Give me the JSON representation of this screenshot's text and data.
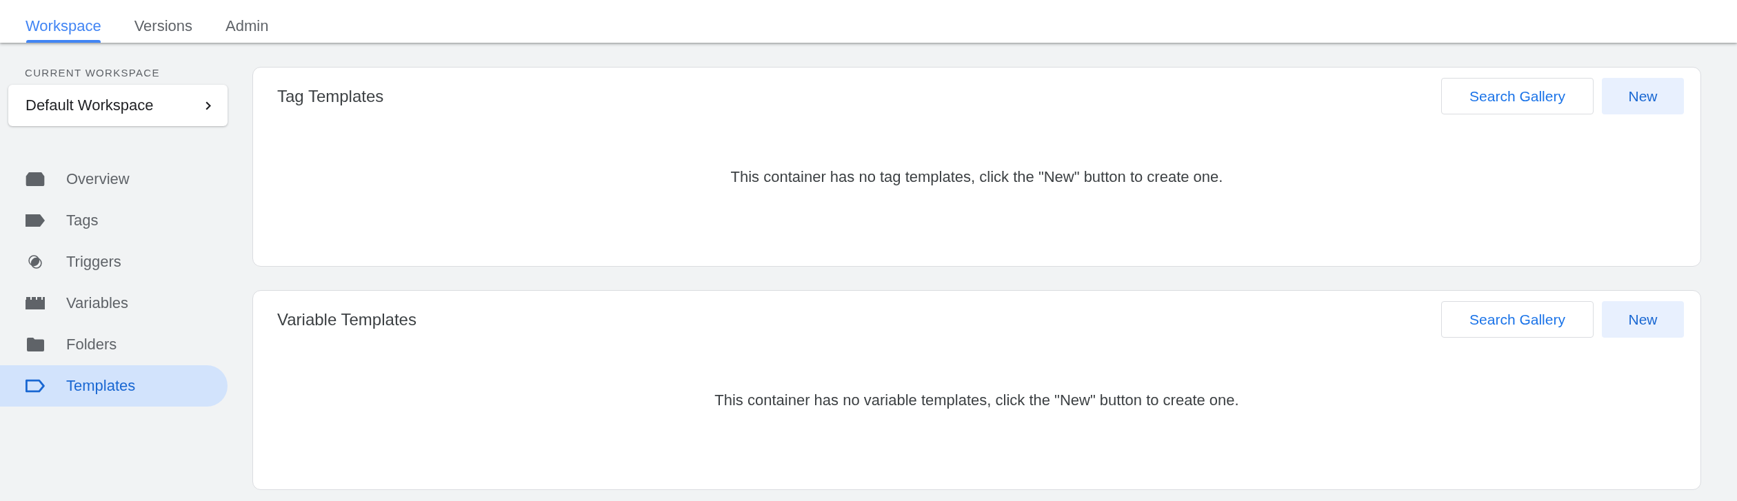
{
  "top_tabs": [
    {
      "label": "Workspace",
      "selected": true
    },
    {
      "label": "Versions",
      "selected": false
    },
    {
      "label": "Admin",
      "selected": false
    }
  ],
  "sidebar": {
    "section_label": "CURRENT WORKSPACE",
    "workspace": "Default Workspace",
    "items": [
      {
        "label": "Overview",
        "selected": false
      },
      {
        "label": "Tags",
        "selected": false
      },
      {
        "label": "Triggers",
        "selected": false
      },
      {
        "label": "Variables",
        "selected": false
      },
      {
        "label": "Folders",
        "selected": false
      },
      {
        "label": "Templates",
        "selected": true
      }
    ]
  },
  "cards": [
    {
      "title": "Tag Templates",
      "buttons": [
        {
          "label": "Search Gallery",
          "kind": "outlined"
        },
        {
          "label": "New",
          "kind": "tonal"
        }
      ],
      "empty_message": "This container has no tag templates, click the \"New\" button to create one."
    },
    {
      "title": "Variable Templates",
      "buttons": [
        {
          "label": "Search Gallery",
          "kind": "outlined"
        },
        {
          "label": "New",
          "kind": "tonal"
        }
      ],
      "empty_message": "This container has no variable templates, click the \"New\" button to create one."
    }
  ]
}
